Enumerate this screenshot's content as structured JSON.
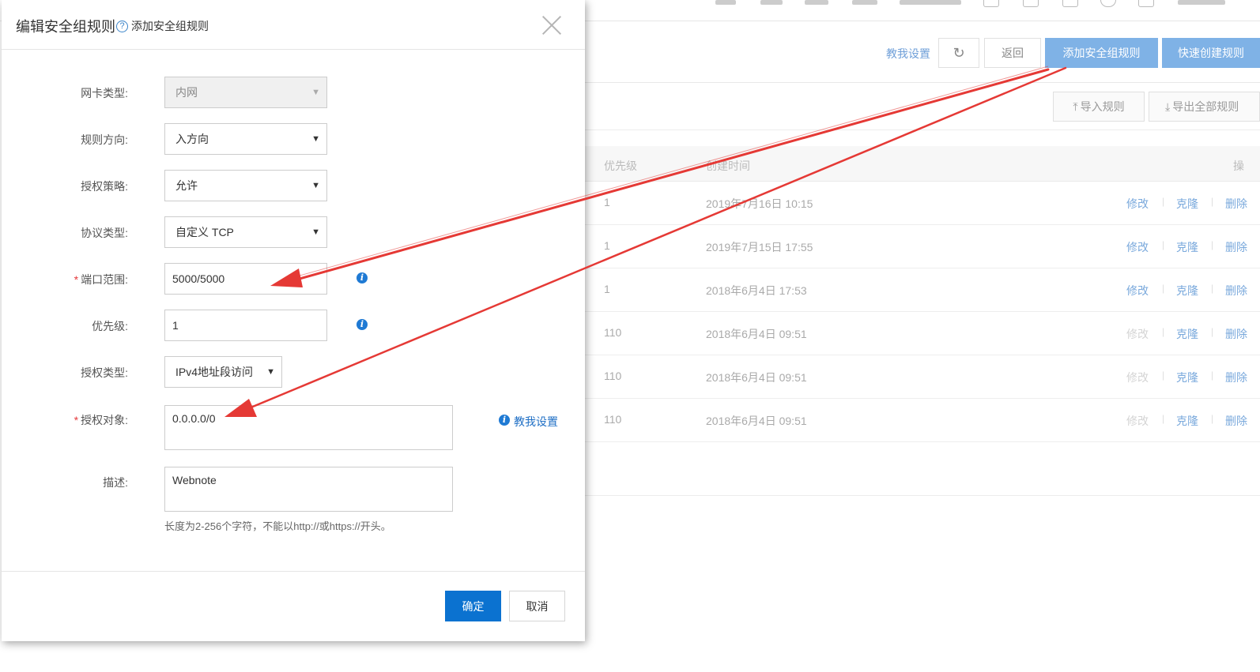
{
  "page": {
    "toolbar": {
      "teach_label": "教我设置",
      "refresh_icon": "refresh-icon",
      "back_label": "返回",
      "add_label": "添加安全组规则",
      "quick_label": "快速创建规则",
      "import_label": "导入规则",
      "export_label": "导出全部规则"
    },
    "table": {
      "headers": {
        "priority": "优先级",
        "created": "创建时间",
        "actions": "操"
      },
      "rows": [
        {
          "priority": "1",
          "created": "2019年7月16日 10:15",
          "modify": "修改",
          "clone": "克隆",
          "delete": "删除",
          "modify_enabled": true
        },
        {
          "priority": "1",
          "created": "2019年7月15日 17:55",
          "modify": "修改",
          "clone": "克隆",
          "delete": "删除",
          "modify_enabled": true
        },
        {
          "priority": "1",
          "created": "2018年6月4日 17:53",
          "modify": "修改",
          "clone": "克隆",
          "delete": "删除",
          "modify_enabled": true
        },
        {
          "priority": "110",
          "created": "2018年6月4日 09:51",
          "modify": "修改",
          "clone": "克隆",
          "delete": "删除",
          "modify_enabled": false
        },
        {
          "priority": "110",
          "created": "2018年6月4日 09:51",
          "modify": "修改",
          "clone": "克隆",
          "delete": "删除",
          "modify_enabled": false
        },
        {
          "priority": "110",
          "created": "2018年6月4日 09:51",
          "modify": "修改",
          "clone": "克隆",
          "delete": "删除",
          "modify_enabled": false
        }
      ]
    }
  },
  "modal": {
    "title": "编辑安全组规则",
    "help_link": "添加安全组规则",
    "fields": {
      "nic_type": {
        "label": "网卡类型:",
        "value": "内网"
      },
      "direction": {
        "label": "规则方向:",
        "value": "入方向"
      },
      "policy": {
        "label": "授权策略:",
        "value": "允许"
      },
      "protocol": {
        "label": "协议类型:",
        "value": "自定义 TCP"
      },
      "port_range": {
        "label": "端口范围:",
        "value": "5000/5000",
        "required": "*"
      },
      "priority": {
        "label": "优先级:",
        "value": "1"
      },
      "auth_type": {
        "label": "授权类型:",
        "value": "IPv4地址段访问"
      },
      "auth_object": {
        "label": "授权对象:",
        "value": "0.0.0.0/0",
        "required": "*"
      },
      "description": {
        "label": "描述:",
        "value": "Webnote"
      }
    },
    "teach_link": "教我设置",
    "hint": "长度为2-256个字符，不能以http://或https://开头。",
    "ok_label": "确定",
    "cancel_label": "取消"
  },
  "colors": {
    "primary": "#0b72d0",
    "primary_light": "#7fb2e6",
    "annotation_arrow": "#e53935",
    "required": "#e4393c"
  }
}
